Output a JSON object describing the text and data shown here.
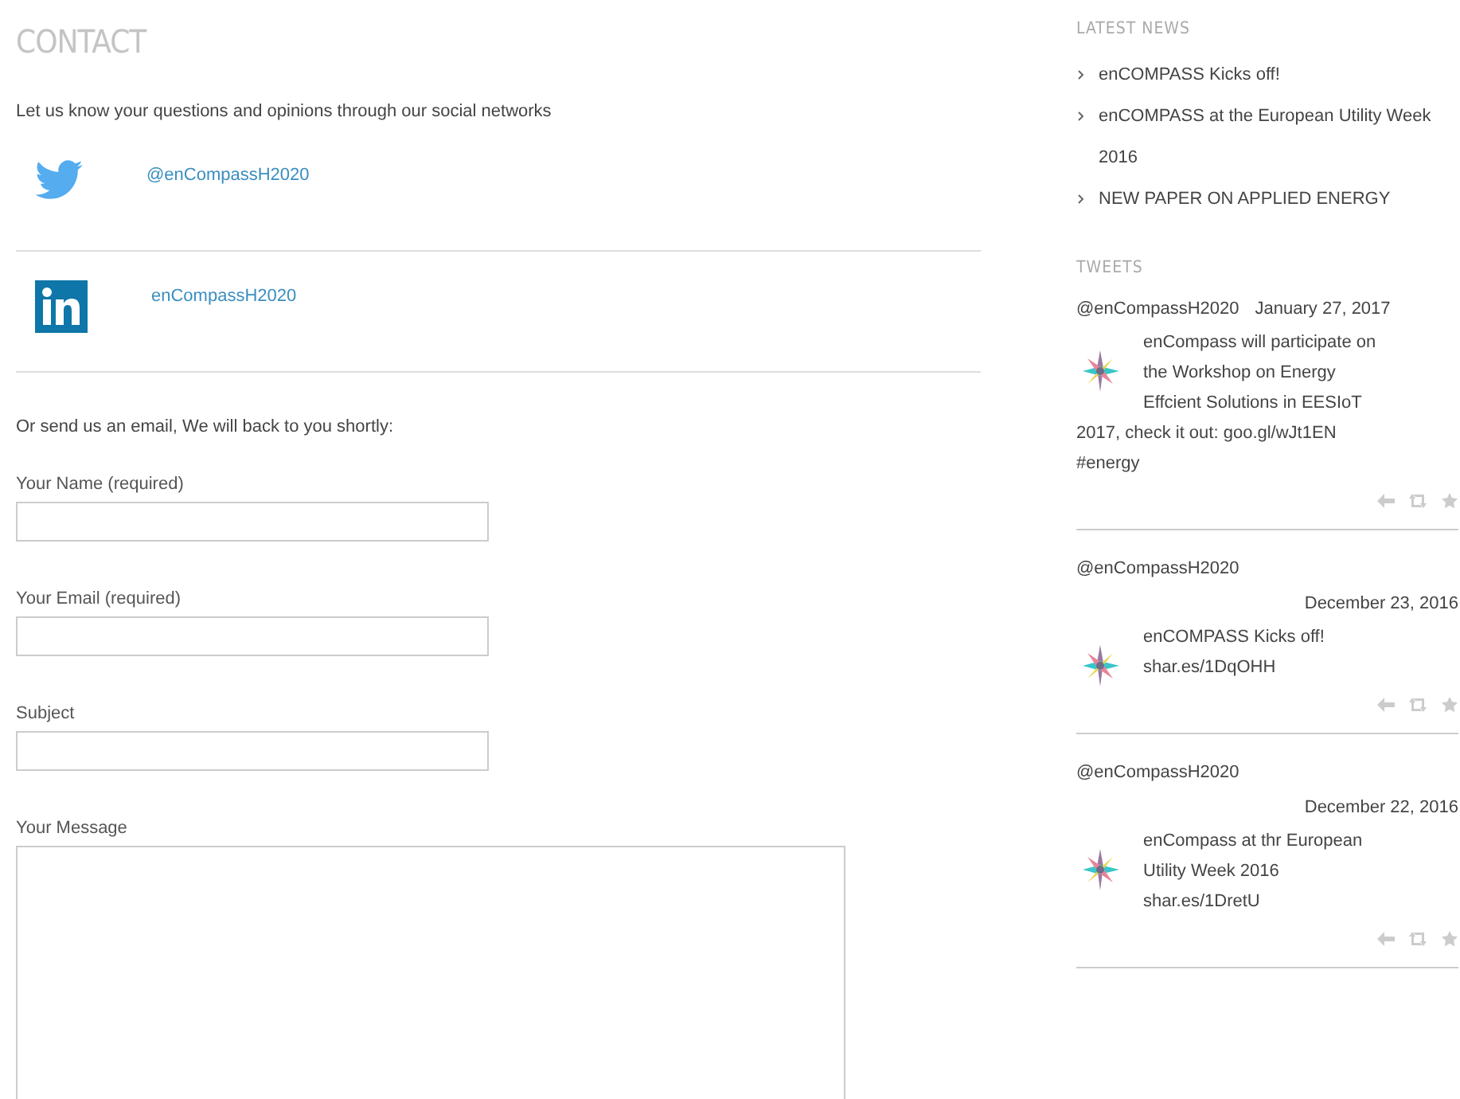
{
  "title": "CONTACT",
  "intro": "Let us know your questions and opinions through our social networks",
  "social": [
    {
      "kind": "twitter",
      "handle": "@enCompassH2020"
    },
    {
      "kind": "linkedin",
      "handle": "enCompassH2020"
    }
  ],
  "email_intro": "Or send us an email, We will back to you shortly:",
  "fields": [
    {
      "kind": "input",
      "label": "Your Name (required)"
    },
    {
      "kind": "input",
      "label": "Your Email (required)"
    },
    {
      "kind": "input",
      "label": "Subject"
    },
    {
      "kind": "textarea",
      "label": "Your Message"
    }
  ],
  "latest_news": {
    "heading": "LATEST NEWS",
    "items": [
      "enCOMPASS Kicks off!",
      "enCOMPASS at the European Utility Week 2016",
      "NEW PAPER ON APPLIED ENERGY"
    ]
  },
  "tweets": {
    "heading": "TWEETS",
    "items": [
      {
        "author": "@enCompassH2020",
        "date": "January 27, 2017",
        "lines": [
          "enCompass will participate on",
          "the Workshop on Energy",
          "Effcient Solutions in EESIoT",
          "2017, check it out: goo.gl/wJt1EN",
          "#energy"
        ],
        "date_below": false
      },
      {
        "author": "@enCompassH2020",
        "date": "December 23, 2016",
        "lines": [
          "enCOMPASS Kicks off!",
          "shar.es/1DqOHH"
        ],
        "date_below": true
      },
      {
        "author": "@enCompassH2020",
        "date": "December 22, 2016",
        "lines": [
          "enCompass at thr European",
          "Utility Week 2016",
          "shar.es/1DretU"
        ],
        "date_below": true
      }
    ]
  }
}
